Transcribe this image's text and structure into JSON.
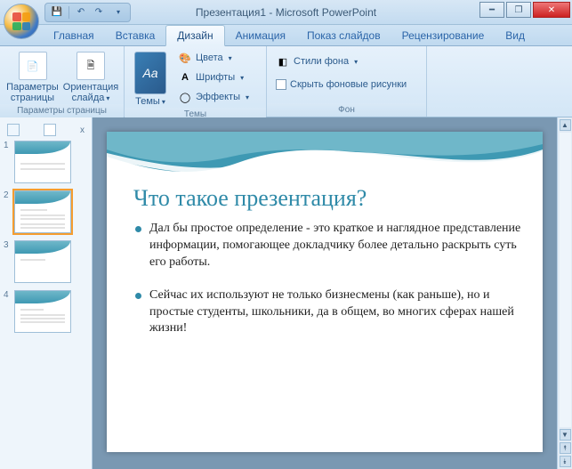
{
  "title": "Презентация1 - Microsoft PowerPoint",
  "qat": {
    "save": "save",
    "undo": "undo",
    "redo": "redo"
  },
  "tabs": {
    "items": [
      {
        "label": "Главная"
      },
      {
        "label": "Вставка"
      },
      {
        "label": "Дизайн"
      },
      {
        "label": "Анимация"
      },
      {
        "label": "Показ слайдов"
      },
      {
        "label": "Рецензирование"
      },
      {
        "label": "Вид"
      }
    ],
    "active_index": 2
  },
  "ribbon": {
    "group_page": {
      "label": "Параметры страницы",
      "btn_page_setup": "Параметры\nстраницы",
      "btn_orientation": "Ориентация\nслайда"
    },
    "group_themes": {
      "label": "Темы",
      "btn_themes": "Темы",
      "colors": "Цвета",
      "fonts": "Шрифты",
      "effects": "Эффекты"
    },
    "group_background": {
      "label": "Фон",
      "bg_styles": "Стили фона",
      "hide_bg": "Скрыть фоновые рисунки"
    }
  },
  "thumbs": {
    "close": "x",
    "items": [
      {
        "num": "1"
      },
      {
        "num": "2"
      },
      {
        "num": "3"
      },
      {
        "num": "4"
      }
    ],
    "selected_index": 1
  },
  "slide": {
    "title": "Что такое презентация?",
    "bullets": [
      "Дал бы простое определение - это краткое и наглядное представление информации, помогающее докладчику более детально раскрыть суть его работы.",
      "Сейчас их используют не только бизнесмены (как раньше), но и простые студенты, школьники, да в общем, во многих сферах нашей жизни!"
    ]
  }
}
